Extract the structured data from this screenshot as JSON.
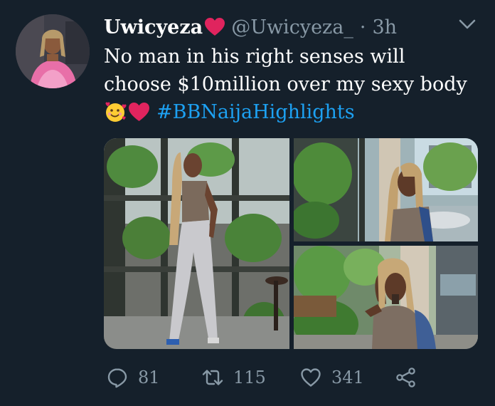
{
  "tweet": {
    "display_name": "Uwicyeza",
    "name_emoji": "red-heart",
    "handle": "@Uwicyeza_",
    "separator": "·",
    "time": "3h",
    "text_line1": "No man in his right senses will",
    "text_line2": "choose $10million over my sexy body",
    "text_emojis": [
      "smiling-face-with-hearts",
      "red-heart"
    ],
    "hashtag": "#BBNaijaHighlights",
    "media_count": 3
  },
  "actions": {
    "replies": "81",
    "retweets": "115",
    "likes": "341",
    "share_icon": "share-icon"
  },
  "colors": {
    "background": "#15202b",
    "text": "#ffffff",
    "secondary": "#8899a6",
    "link": "#1da1f2",
    "heart": "#e0245e"
  }
}
